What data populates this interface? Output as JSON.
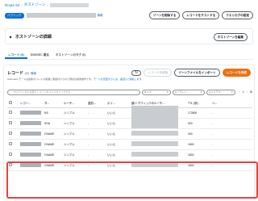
{
  "breadcrumb": {
    "root": "Route 53",
    "section": "ホストゾーン"
  },
  "header": {
    "badge": "パブリック",
    "info": "情報",
    "buttons": [
      "ゾーンを削除する",
      "レコードをテストする",
      "クエリログの設定"
    ]
  },
  "details": {
    "title": "ホストゾーンの詳細",
    "edit_button": "ホストゾーンを編集"
  },
  "tabs": [
    "レコード (6)",
    "DNSSEC 署名",
    "ホストゾーンのタグ (0)"
  ],
  "records": {
    "title": "レコード",
    "count": "(6)",
    "info": "情報",
    "refresh_icon": "refresh-icon",
    "delete_button": "レコードを削除",
    "import_button": "ゾーンファイルをインポート",
    "create_button": "レコードを作成",
    "description": "Automatic モードは最新のフィルタ処理と関連付けられた現在の検索動作です。",
    "description_link": "モードを変更するには、[設定] に移動します。",
    "search_placeholder": "プロパティまたは値でレコードをフィルタリングする",
    "filters": [
      "タイプ",
      "ルーティン...",
      "エイリアス"
    ],
    "page": "1",
    "columns": [
      "",
      "レコー...",
      "タ...",
      "ルーテ...",
      "差別...",
      "エイ...",
      "値/トラフィックのルーテ...",
      "TTL (秒)",
      "ヘ..."
    ],
    "rows": [
      {
        "type": "NS",
        "routing": "シンプル",
        "diff": "-",
        "alias": "いいえ",
        "ttl": "172800",
        "health": "-"
      },
      {
        "type": "SOA",
        "routing": "シンプル",
        "diff": "-",
        "alias": "いいえ",
        "ttl": "900",
        "health": "-"
      },
      {
        "type": "CNAME",
        "routing": "シンプル",
        "diff": "-",
        "alias": "いいえ",
        "ttl": "300",
        "health": "-"
      },
      {
        "type": "CNAME",
        "routing": "シンプル",
        "diff": "-",
        "alias": "いいえ",
        "ttl": "1800",
        "health": "-"
      },
      {
        "type": "CNAME",
        "routing": "シンプル",
        "diff": "-",
        "alias": "いいえ",
        "ttl": "1800",
        "health": "-"
      },
      {
        "type": "CNAME",
        "routing": "シンプル",
        "diff": "-",
        "alias": "いいえ",
        "ttl": "1800",
        "health": "-"
      }
    ]
  },
  "colors": {
    "accent": "#0972d3",
    "primary_button": "#ec7211",
    "highlight": "#e0463d"
  }
}
